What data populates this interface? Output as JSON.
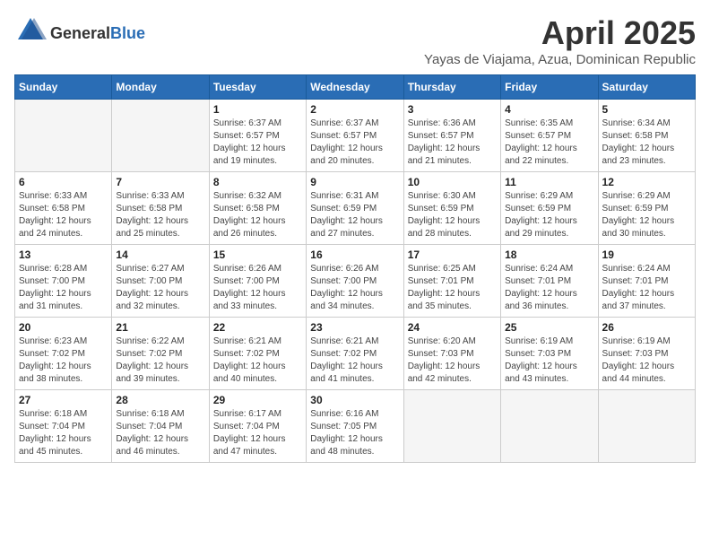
{
  "logo": {
    "text_general": "General",
    "text_blue": "Blue"
  },
  "title": "April 2025",
  "subtitle": "Yayas de Viajama, Azua, Dominican Republic",
  "days_of_week": [
    "Sunday",
    "Monday",
    "Tuesday",
    "Wednesday",
    "Thursday",
    "Friday",
    "Saturday"
  ],
  "weeks": [
    [
      {
        "day": "",
        "sunrise": "",
        "sunset": "",
        "daylight": ""
      },
      {
        "day": "",
        "sunrise": "",
        "sunset": "",
        "daylight": ""
      },
      {
        "day": "1",
        "sunrise": "Sunrise: 6:37 AM",
        "sunset": "Sunset: 6:57 PM",
        "daylight": "Daylight: 12 hours and 19 minutes."
      },
      {
        "day": "2",
        "sunrise": "Sunrise: 6:37 AM",
        "sunset": "Sunset: 6:57 PM",
        "daylight": "Daylight: 12 hours and 20 minutes."
      },
      {
        "day": "3",
        "sunrise": "Sunrise: 6:36 AM",
        "sunset": "Sunset: 6:57 PM",
        "daylight": "Daylight: 12 hours and 21 minutes."
      },
      {
        "day": "4",
        "sunrise": "Sunrise: 6:35 AM",
        "sunset": "Sunset: 6:57 PM",
        "daylight": "Daylight: 12 hours and 22 minutes."
      },
      {
        "day": "5",
        "sunrise": "Sunrise: 6:34 AM",
        "sunset": "Sunset: 6:58 PM",
        "daylight": "Daylight: 12 hours and 23 minutes."
      }
    ],
    [
      {
        "day": "6",
        "sunrise": "Sunrise: 6:33 AM",
        "sunset": "Sunset: 6:58 PM",
        "daylight": "Daylight: 12 hours and 24 minutes."
      },
      {
        "day": "7",
        "sunrise": "Sunrise: 6:33 AM",
        "sunset": "Sunset: 6:58 PM",
        "daylight": "Daylight: 12 hours and 25 minutes."
      },
      {
        "day": "8",
        "sunrise": "Sunrise: 6:32 AM",
        "sunset": "Sunset: 6:58 PM",
        "daylight": "Daylight: 12 hours and 26 minutes."
      },
      {
        "day": "9",
        "sunrise": "Sunrise: 6:31 AM",
        "sunset": "Sunset: 6:59 PM",
        "daylight": "Daylight: 12 hours and 27 minutes."
      },
      {
        "day": "10",
        "sunrise": "Sunrise: 6:30 AM",
        "sunset": "Sunset: 6:59 PM",
        "daylight": "Daylight: 12 hours and 28 minutes."
      },
      {
        "day": "11",
        "sunrise": "Sunrise: 6:29 AM",
        "sunset": "Sunset: 6:59 PM",
        "daylight": "Daylight: 12 hours and 29 minutes."
      },
      {
        "day": "12",
        "sunrise": "Sunrise: 6:29 AM",
        "sunset": "Sunset: 6:59 PM",
        "daylight": "Daylight: 12 hours and 30 minutes."
      }
    ],
    [
      {
        "day": "13",
        "sunrise": "Sunrise: 6:28 AM",
        "sunset": "Sunset: 7:00 PM",
        "daylight": "Daylight: 12 hours and 31 minutes."
      },
      {
        "day": "14",
        "sunrise": "Sunrise: 6:27 AM",
        "sunset": "Sunset: 7:00 PM",
        "daylight": "Daylight: 12 hours and 32 minutes."
      },
      {
        "day": "15",
        "sunrise": "Sunrise: 6:26 AM",
        "sunset": "Sunset: 7:00 PM",
        "daylight": "Daylight: 12 hours and 33 minutes."
      },
      {
        "day": "16",
        "sunrise": "Sunrise: 6:26 AM",
        "sunset": "Sunset: 7:00 PM",
        "daylight": "Daylight: 12 hours and 34 minutes."
      },
      {
        "day": "17",
        "sunrise": "Sunrise: 6:25 AM",
        "sunset": "Sunset: 7:01 PM",
        "daylight": "Daylight: 12 hours and 35 minutes."
      },
      {
        "day": "18",
        "sunrise": "Sunrise: 6:24 AM",
        "sunset": "Sunset: 7:01 PM",
        "daylight": "Daylight: 12 hours and 36 minutes."
      },
      {
        "day": "19",
        "sunrise": "Sunrise: 6:24 AM",
        "sunset": "Sunset: 7:01 PM",
        "daylight": "Daylight: 12 hours and 37 minutes."
      }
    ],
    [
      {
        "day": "20",
        "sunrise": "Sunrise: 6:23 AM",
        "sunset": "Sunset: 7:02 PM",
        "daylight": "Daylight: 12 hours and 38 minutes."
      },
      {
        "day": "21",
        "sunrise": "Sunrise: 6:22 AM",
        "sunset": "Sunset: 7:02 PM",
        "daylight": "Daylight: 12 hours and 39 minutes."
      },
      {
        "day": "22",
        "sunrise": "Sunrise: 6:21 AM",
        "sunset": "Sunset: 7:02 PM",
        "daylight": "Daylight: 12 hours and 40 minutes."
      },
      {
        "day": "23",
        "sunrise": "Sunrise: 6:21 AM",
        "sunset": "Sunset: 7:02 PM",
        "daylight": "Daylight: 12 hours and 41 minutes."
      },
      {
        "day": "24",
        "sunrise": "Sunrise: 6:20 AM",
        "sunset": "Sunset: 7:03 PM",
        "daylight": "Daylight: 12 hours and 42 minutes."
      },
      {
        "day": "25",
        "sunrise": "Sunrise: 6:19 AM",
        "sunset": "Sunset: 7:03 PM",
        "daylight": "Daylight: 12 hours and 43 minutes."
      },
      {
        "day": "26",
        "sunrise": "Sunrise: 6:19 AM",
        "sunset": "Sunset: 7:03 PM",
        "daylight": "Daylight: 12 hours and 44 minutes."
      }
    ],
    [
      {
        "day": "27",
        "sunrise": "Sunrise: 6:18 AM",
        "sunset": "Sunset: 7:04 PM",
        "daylight": "Daylight: 12 hours and 45 minutes."
      },
      {
        "day": "28",
        "sunrise": "Sunrise: 6:18 AM",
        "sunset": "Sunset: 7:04 PM",
        "daylight": "Daylight: 12 hours and 46 minutes."
      },
      {
        "day": "29",
        "sunrise": "Sunrise: 6:17 AM",
        "sunset": "Sunset: 7:04 PM",
        "daylight": "Daylight: 12 hours and 47 minutes."
      },
      {
        "day": "30",
        "sunrise": "Sunrise: 6:16 AM",
        "sunset": "Sunset: 7:05 PM",
        "daylight": "Daylight: 12 hours and 48 minutes."
      },
      {
        "day": "",
        "sunrise": "",
        "sunset": "",
        "daylight": ""
      },
      {
        "day": "",
        "sunrise": "",
        "sunset": "",
        "daylight": ""
      },
      {
        "day": "",
        "sunrise": "",
        "sunset": "",
        "daylight": ""
      }
    ]
  ]
}
